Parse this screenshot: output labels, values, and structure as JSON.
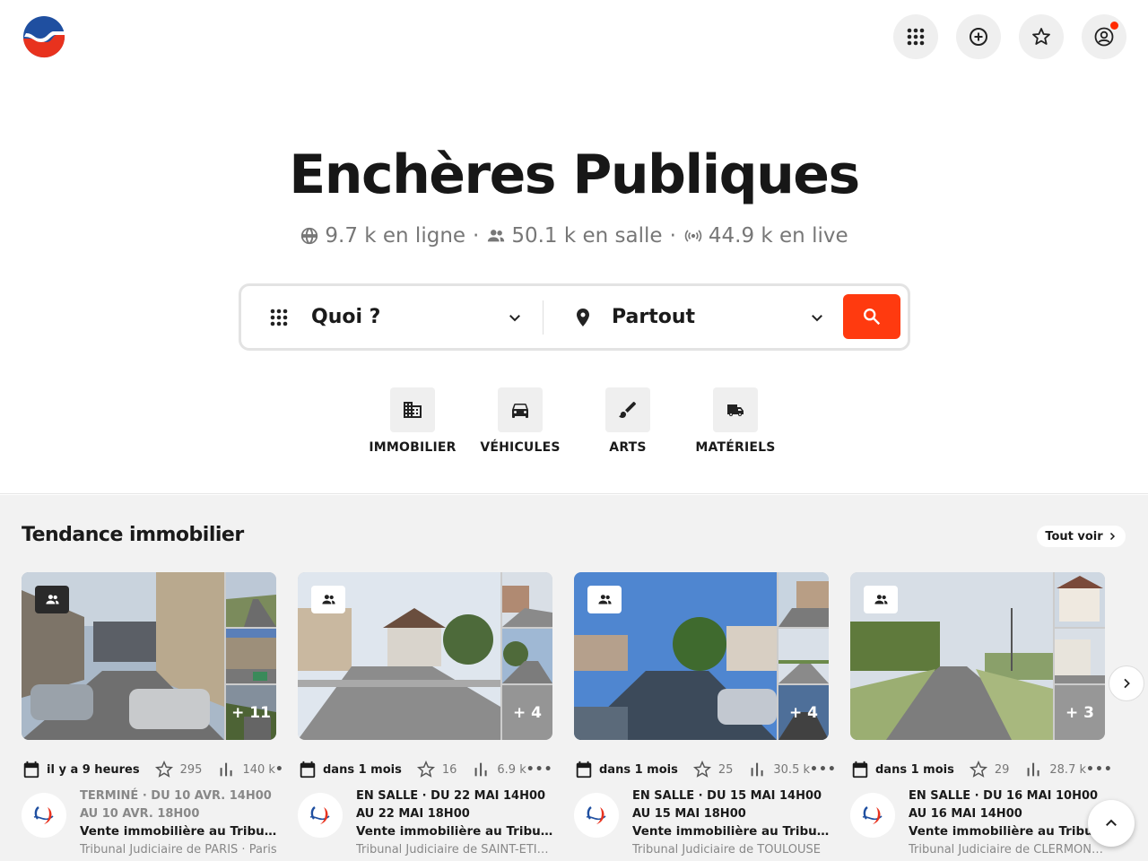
{
  "header": {
    "logo_name": "encheres-publiques-logo",
    "buttons": [
      "apps-icon",
      "add-icon",
      "star-icon",
      "account-icon"
    ]
  },
  "hero": {
    "title": "Enchères Publiques",
    "stats": {
      "online": "9.7 k en ligne",
      "in_room": "50.1 k en salle",
      "live": "44.9 k en live",
      "separator": "·"
    }
  },
  "search": {
    "what_value": "Quoi ?",
    "where_value": "Partout"
  },
  "categories": [
    {
      "label": "IMMOBILIER",
      "icon": "building-icon"
    },
    {
      "label": "VÉHICULES",
      "icon": "car-icon"
    },
    {
      "label": "ARTS",
      "icon": "brush-icon"
    },
    {
      "label": "MATÉRIELS",
      "icon": "truck-icon"
    }
  ],
  "section": {
    "title": "Tendance immobilier",
    "see_all": "Tout voir"
  },
  "cards": [
    {
      "date": "il y a 9 heures",
      "favorites": "295",
      "views": "140 k",
      "more": "•",
      "extra_photos": "+ 11",
      "status": "TERMINÉ · DU 10 AVR. 14H00 AU 10 AVR. 18H00",
      "ended": true,
      "title": "Vente immobilière au Tribunal Judiciaire de Paris",
      "place": "Tribunal Judiciaire de PARIS · Paris"
    },
    {
      "date": "dans 1 mois",
      "favorites": "16",
      "views": "6.9 k",
      "more": "•••",
      "extra_photos": "+ 4",
      "status": "EN SALLE · DU 22 MAI 14H00 AU 22 MAI 18H00",
      "ended": false,
      "title": "Vente immobilière au Tribunal Judiciaire de Saint-Étienne",
      "place": "Tribunal Judiciaire de SAINT-ETIENNE"
    },
    {
      "date": "dans 1 mois",
      "favorites": "25",
      "views": "30.5 k",
      "more": "•••",
      "extra_photos": "+ 4",
      "status": "EN SALLE · DU 15 MAI 14H00 AU 15 MAI 18H00",
      "ended": false,
      "title": "Vente immobilière au Tribunal Judiciaire de Toulouse",
      "place": "Tribunal Judiciaire de TOULOUSE"
    },
    {
      "date": "dans 1 mois",
      "favorites": "29",
      "views": "28.7 k",
      "more": "•••",
      "extra_photos": "+ 3",
      "status": "EN SALLE · DU 16 MAI 10H00 AU 16 MAI 14H00",
      "ended": false,
      "title": "Vente immobilière au Tribunal Judiciaire de Clermont",
      "place": "Tribunal Judiciaire de CLERMONT-FERRAND"
    }
  ],
  "colors": {
    "accent": "#ff3a0f",
    "logo_blue": "#1f4fa0",
    "logo_red": "#e8321e"
  }
}
